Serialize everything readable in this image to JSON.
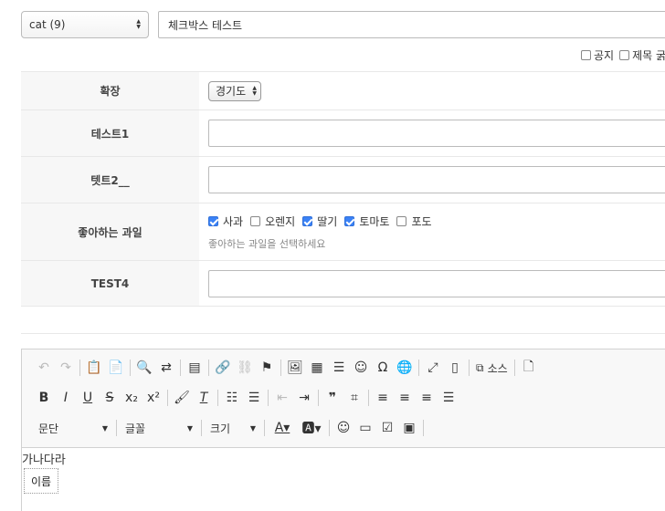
{
  "category": {
    "value": "cat (9)"
  },
  "title": {
    "value": "체크박스 테스트"
  },
  "options": [
    {
      "label": "공지",
      "checked": false
    },
    {
      "label": "제목 굵",
      "checked": false
    }
  ],
  "form": {
    "rows": [
      {
        "label": "확장",
        "select_value": "경기도"
      },
      {
        "label": "테스트1"
      },
      {
        "label": "텟트2__"
      },
      {
        "label": "좋아하는 과일",
        "fruits": [
          {
            "label": "사과",
            "checked": true
          },
          {
            "label": "오렌지",
            "checked": false
          },
          {
            "label": "딸기",
            "checked": true
          },
          {
            "label": "토마토",
            "checked": true
          },
          {
            "label": "포도",
            "checked": false
          }
        ],
        "help": "좋아하는 과일을 선택하세요"
      },
      {
        "label": "TEST4"
      }
    ]
  },
  "editor": {
    "toolbar": {
      "source_label": "소스",
      "format_combo": "문단",
      "font_combo": "글꼴",
      "size_combo": "크기"
    },
    "content_text": "가나다라",
    "name_box": "이름"
  }
}
